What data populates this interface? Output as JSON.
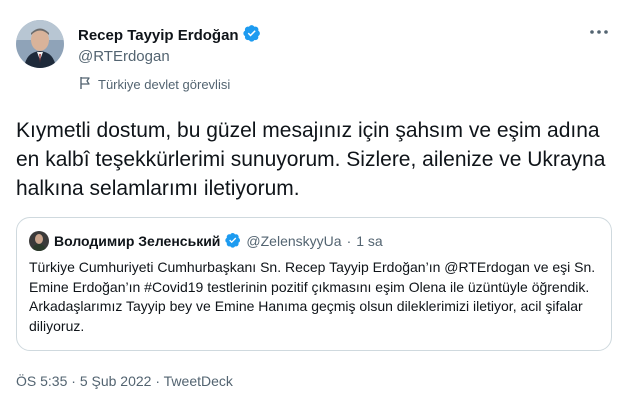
{
  "author": {
    "display_name": "Recep Tayyip Erdoğan",
    "handle": "@RTErdogan",
    "label": "Türkiye devlet görevlisi",
    "verified_icon": "verified-badge-icon",
    "label_icon": "flag-icon"
  },
  "tweet": {
    "text": "Kıymetli dostum, bu güzel mesajınız için şahsım ve eşim adına en kalbî teşekkürlerimi sunuyorum. Sizlere, ailenize ve Ukrayna halkına selamlarımı iletiyorum."
  },
  "quoted": {
    "display_name": "Володимир Зеленський",
    "handle": "@ZelenskyyUa",
    "separator": "·",
    "time": "1 sa",
    "text": "Türkiye Cumhuriyeti Cumhurbaşkanı Sn. Recep Tayyip Erdoğan’ın @RTErdogan ve eşi Sn. Emine Erdoğan’ın #Covid19 testlerinin pozitif çıkmasını eşim Olena ile üzüntüyle öğrendik. Arkadaşlarımız Tayyip bey ve Emine Hanıma geçmiş olsun dileklerimizi iletiyor, acil şifalar diliyoruz."
  },
  "footer": {
    "time": "ÖS 5:35",
    "separator": "·",
    "date": "5 Şub 2022",
    "source": "TweetDeck"
  },
  "colors": {
    "verified": "#1d9bf0",
    "secondary_text": "#536471",
    "border": "#cfd9de"
  }
}
